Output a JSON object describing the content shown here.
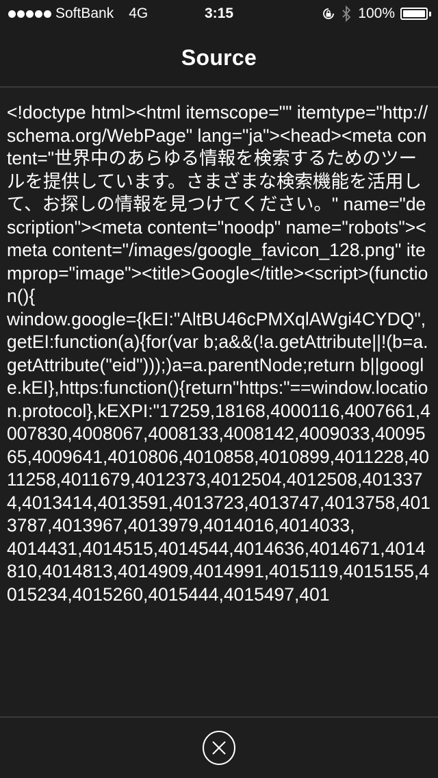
{
  "status_bar": {
    "signal_bars": 5,
    "carrier": "SoftBank",
    "network": "4G",
    "time": "3:15",
    "icons": [
      "rotation-lock-icon",
      "bluetooth-icon"
    ],
    "battery_percent_label": "100%",
    "battery_level": 1.0
  },
  "nav_bar": {
    "title": "Source"
  },
  "content": {
    "source_text": "<!doctype html><html itemscope=\"\" itemtype=\"http://schema.org/WebPage\" lang=\"ja\"><head><meta content=\"世界中のあらゆる情報を検索するためのツールを提供しています。さまざまな検索機能を活用して、お探しの情報を見つけてください。\" name=\"description\"><meta content=\"noodp\" name=\"robots\"><meta content=\"/images/google_favicon_128.png\" itemprop=\"image\"><title>Google</title><script>(function(){\nwindow.google={kEI:\"AltBU46cPMXqlAWgi4CYDQ\",getEI:function(a){for(var b;a&&(!a.getAttribute||!(b=a.getAttribute(\"eid\")));)a=a.parentNode;return b||google.kEI},https:function(){return\"https:\"==window.location.protocol},kEXPI:\"17259,18168,4000116,4007661,4007830,4008067,4008133,4008142,4009033,4009565,4009641,4010806,4010858,4010899,4011228,4011258,4011679,4012373,4012504,4012508,4013374,4013414,4013591,4013723,4013747,4013758,4013787,4013967,4013979,4014016,4014033,\n4014431,4014515,4014544,4014636,4014671,4014810,4014813,4014909,4014991,4015119,4015155,4015234,4015260,4015444,4015497,401"
  },
  "toolbar": {
    "close_icon": "close-circle-icon"
  }
}
